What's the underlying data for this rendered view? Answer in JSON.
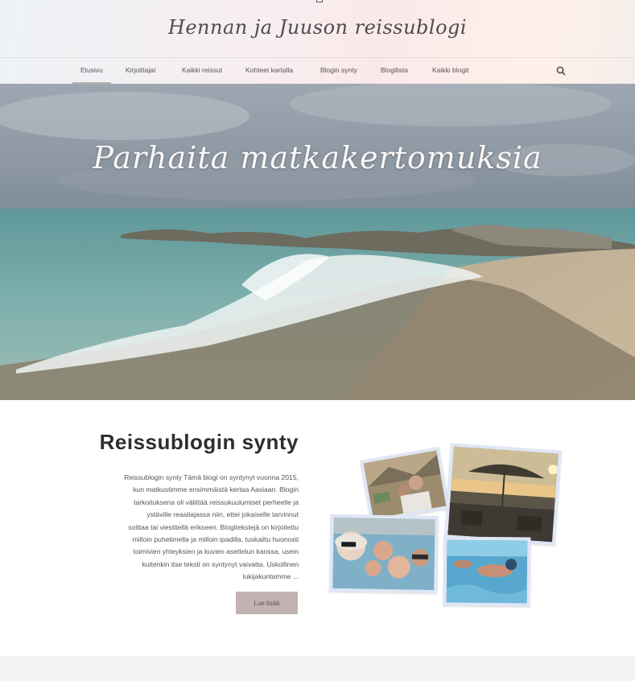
{
  "site": {
    "title": "Hennan ja Juuson reissublogi"
  },
  "nav": {
    "items": [
      {
        "label": "Etusivu",
        "active": true
      },
      {
        "label": "Kirjoittajat"
      },
      {
        "label": "Kaikki reissut"
      },
      {
        "label": "Kohteet kartalla"
      },
      {
        "label": "Blogin synty"
      },
      {
        "label": "Blogilista"
      },
      {
        "label": "Kaikki blogit"
      }
    ],
    "search_icon": "search-icon"
  },
  "hero": {
    "title": "Parhaita matkakertomuksia"
  },
  "post": {
    "title": "Reissublogin synty",
    "excerpt_lines": [
      "Reissublogin synty Tämä blogi on syntynyt vuonna 2015,",
      "kun matkustimme ensimmäistä kertaa Aasiaan. Blogin",
      "tarkoituksena oli välittää reissukuulumiset perheelle ja",
      "ystäville reaaliajassa niin, ettei jokaiselle tarvinnut",
      "soittaa tai viestitellä erikseen. Blogitekstejä on kirjoitettu",
      "milloin puhelimella ja milloin ipadilla, tuskailtu huonosti",
      "toimivien yhteyksien ja kuvien asettelun kanssa, usein",
      "kuitenkin itse teksti on syntynyt vaivatta. Uskollinen",
      "lukijakuntamme ..."
    ],
    "read_more": "Lue lisää"
  },
  "colors": {
    "accent": "#c3b2b2",
    "title": "#4d4d4d",
    "photo_frame": "#dfe6f5"
  }
}
